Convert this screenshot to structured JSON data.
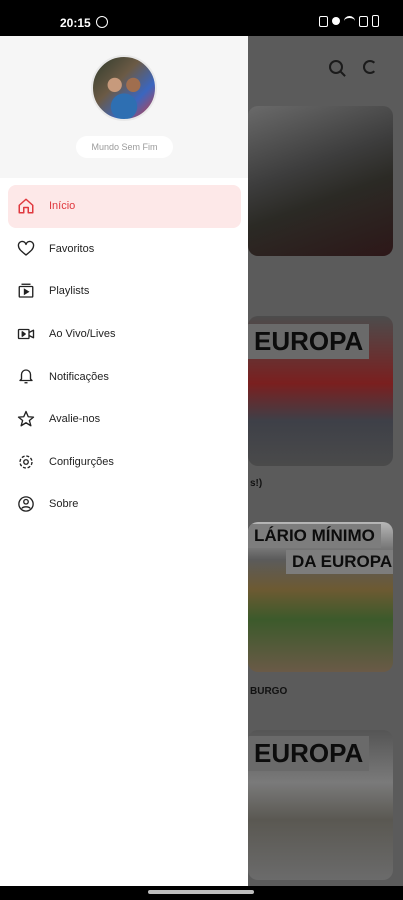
{
  "status_bar": {
    "time": "20:15"
  },
  "drawer": {
    "channel_name": "Mundo Sem Fim",
    "menu_items": [
      {
        "label": "Início",
        "icon": "home-icon",
        "active": true
      },
      {
        "label": "Favoritos",
        "icon": "heart-icon",
        "active": false
      },
      {
        "label": "Playlists",
        "icon": "playlist-icon",
        "active": false
      },
      {
        "label": "Ao Vivo/Lives",
        "icon": "live-video-icon",
        "active": false
      },
      {
        "label": "Notificações",
        "icon": "bell-icon",
        "active": false
      },
      {
        "label": "Avalie-nos",
        "icon": "star-icon",
        "active": false
      },
      {
        "label": "Configurções",
        "icon": "gear-icon",
        "active": false
      },
      {
        "label": "Sobre",
        "icon": "info-person-icon",
        "active": false
      }
    ],
    "accent_color": "#e0383e",
    "active_bg_color": "#fde8e8"
  },
  "background_feed": {
    "thumbnail_texts": [
      "EUROPA",
      "LÁRIO MÍNIMO",
      "DA EUROPA",
      "EUROPA"
    ],
    "captions": [
      "s!)",
      "BURGO"
    ]
  }
}
